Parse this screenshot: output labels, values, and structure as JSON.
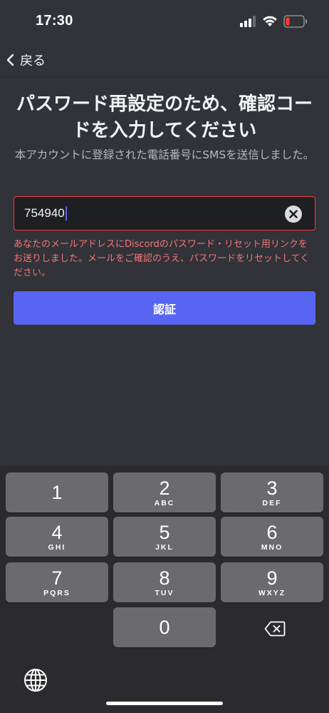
{
  "status_bar": {
    "time": "17:30"
  },
  "nav": {
    "back_label": "戻る"
  },
  "content": {
    "title": "パスワード再設定のため、確認コードを入力してください",
    "subtitle": "本アカウントに登録された電話番号にSMSを送信しました。",
    "code_value": "754940",
    "error": "あなたのメールアドレスにDiscordのパスワード・リセット用リンクをお送りしました。メールをご確認のうえ、パスワードをリセットしてください。",
    "verify_label": "認証"
  },
  "colors": {
    "background": "#313338",
    "accent": "#5865f2",
    "error": "#f23f43",
    "error_text": "#f47679"
  },
  "icons": {
    "back": "chevron-left-icon",
    "clear": "clear-circle-icon",
    "delete": "backspace-icon",
    "globe": "globe-icon"
  },
  "keypad": {
    "keys": [
      {
        "digit": "1",
        "letters": ""
      },
      {
        "digit": "2",
        "letters": "ABC"
      },
      {
        "digit": "3",
        "letters": "DEF"
      },
      {
        "digit": "4",
        "letters": "GHI"
      },
      {
        "digit": "5",
        "letters": "JKL"
      },
      {
        "digit": "6",
        "letters": "MNO"
      },
      {
        "digit": "7",
        "letters": "PQRS"
      },
      {
        "digit": "8",
        "letters": "TUV"
      },
      {
        "digit": "9",
        "letters": "WXYZ"
      },
      {
        "digit": "0",
        "letters": ""
      }
    ]
  }
}
